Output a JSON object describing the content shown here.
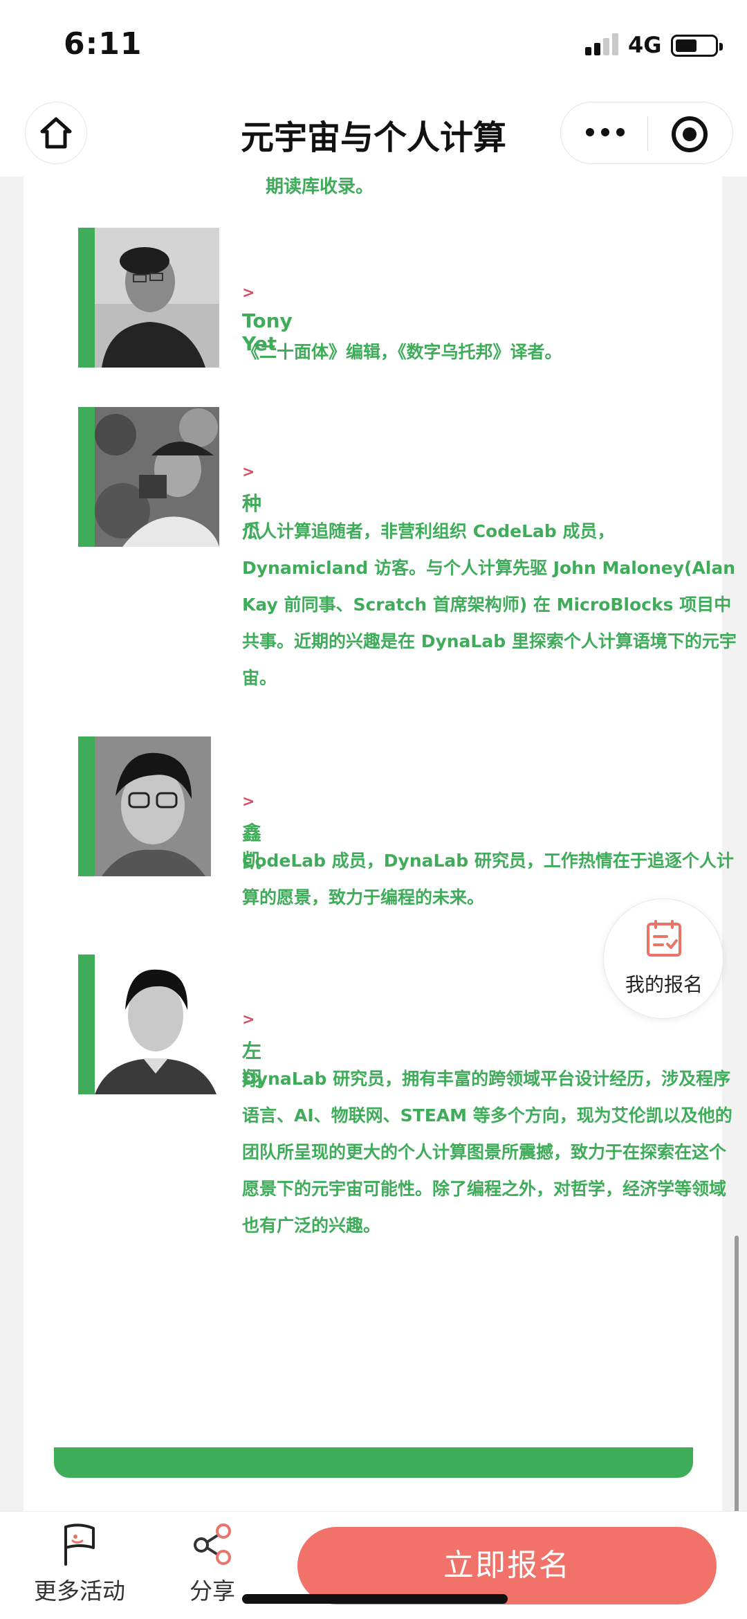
{
  "status_bar": {
    "time": "6:11",
    "network": "4G"
  },
  "title_bar": {
    "title": "元宇宙与个人计算"
  },
  "content": {
    "top_fragment": "期读库收录。",
    "people": [
      {
        "arrow": ">",
        "name": "Tony Yet",
        "bio": "《二十面体》编辑，《数字乌托邦》译者。"
      },
      {
        "arrow": ">",
        "name": "种瓜",
        "bio": "个人计算追随者，非营利组织 CodeLab 成员，Dynamicland 访客。与个人计算先驱 John Maloney(Alan Kay 前同事、Scratch 首席架构师) 在 MicroBlocks 项目中共事。近期的兴趣是在 DynaLab 里探索个人计算语境下的元宇宙。"
      },
      {
        "arrow": ">",
        "name": "鑫凯",
        "bio": "CodeLab 成员，DynaLab 研究员，工作热情在于追逐个人计算的愿景，致力于编程的未来。"
      },
      {
        "arrow": ">",
        "name": "左翔",
        "bio": "DynaLab 研究员，拥有丰富的跨领域平台设计经历，涉及程序语言、AI、物联网、STEAM 等多个方向，现为艾伦凯以及他的团队所呈现的更大的个人计算图景所震撼，致力于在探索在这个愿景下的元宇宙可能性。除了编程之外，对哲学，经济学等领域也有广泛的兴趣。"
      }
    ]
  },
  "floating": {
    "label": "我的报名",
    "icon": "clipboard-check-icon"
  },
  "bottom_bar": {
    "more_label": "更多活动",
    "share_label": "分享",
    "register_label": "立即报名"
  },
  "colors": {
    "accent_green": "#3fac5a",
    "register_red": "#f07269",
    "arrow_pink": "#d64f6a"
  }
}
